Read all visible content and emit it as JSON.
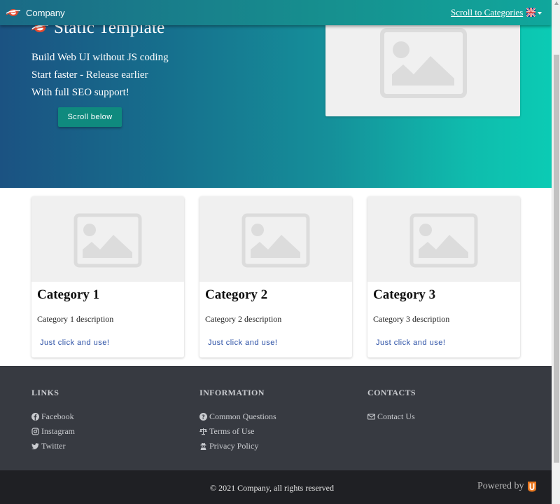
{
  "header": {
    "brand_name": "Company",
    "nav_link": "Scroll to Categories",
    "language_icon": "uk-flag-icon"
  },
  "hero": {
    "title": "Static Template",
    "lines": [
      "Build Web UI without JS coding",
      "Start faster - Release earlier",
      "With full SEO support!"
    ],
    "button_label": "Scroll below"
  },
  "categories": [
    {
      "title": "Category 1",
      "description": "Category 1 description",
      "link": "Just click and use!"
    },
    {
      "title": "Category 2",
      "description": "Category 2 description",
      "link": "Just click and use!"
    },
    {
      "title": "Category 3",
      "description": "Category 3 description",
      "link": "Just click and use!"
    }
  ],
  "footer": {
    "links": {
      "heading": "LINKS",
      "items": [
        {
          "label": "Facebook",
          "icon": "facebook-icon"
        },
        {
          "label": "Instagram",
          "icon": "instagram-icon"
        },
        {
          "label": "Twitter",
          "icon": "twitter-icon"
        }
      ]
    },
    "information": {
      "heading": "INFORMATION",
      "items": [
        {
          "label": "Common Questions",
          "icon": "question-icon"
        },
        {
          "label": "Terms of Use",
          "icon": "balance-scale-icon"
        },
        {
          "label": "Privacy Policy",
          "icon": "user-secret-icon"
        }
      ]
    },
    "contacts": {
      "heading": "CONTACTS",
      "items": [
        {
          "label": "Contact Us",
          "icon": "envelope-icon"
        }
      ]
    },
    "copyright": "© 2021 Company, all rights reserved",
    "powered_by": "Powered by"
  },
  "colors": {
    "hero_gradient_start": "#1b5282",
    "hero_gradient_end": "#0bcbb4",
    "button": "#0f8a7e",
    "footer": "#373a41",
    "bottom_bar": "#1f2024",
    "link": "#2a4fa5",
    "powered_logo": "#e8771f"
  }
}
